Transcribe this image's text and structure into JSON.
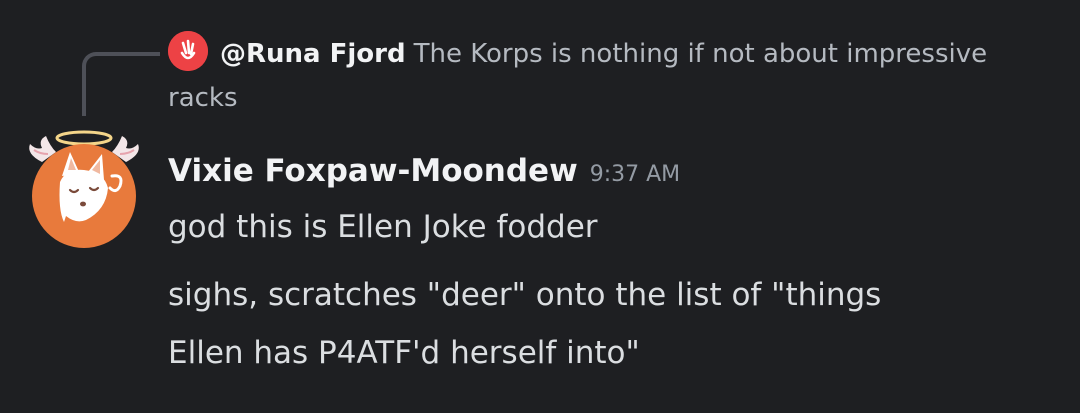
{
  "reply": {
    "author": "@Runa Fjord",
    "text_first": "The Korps is nothing if not about impressive",
    "text_second": "racks",
    "avatar_icon": "hand-icon",
    "avatar_color": "#ed4245"
  },
  "message": {
    "author": "Vixie Foxpaw-Moondew",
    "timestamp": "9:37 AM",
    "avatar_icon": "angel-fox-avatar",
    "avatar_color": "#e87a3c",
    "lines": [
      "god this is Ellen Joke fodder",
      "sighs, scratches \"deer\" onto the list of \"things",
      "Ellen has P4ATF'd herself into\""
    ]
  }
}
